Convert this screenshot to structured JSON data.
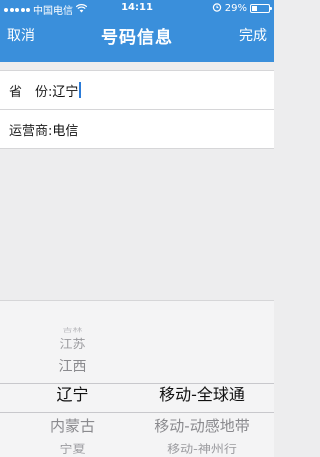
{
  "status_bar": {
    "carrier": "中国电信",
    "time": "14:11",
    "battery_percent_text": "29%",
    "battery_level": 0.29,
    "icons": [
      "wifi-icon",
      "alarm-clock-icon",
      "battery-icon"
    ]
  },
  "nav": {
    "left_label": "取消",
    "title": "号码信息",
    "right_label": "完成"
  },
  "form": {
    "province_label": "省　份:",
    "province_value": "辽宁",
    "carrier_label": "运营商:",
    "carrier_value": "电信"
  },
  "picker": {
    "provinces": [
      "吉林",
      "江苏",
      "江西",
      "辽宁",
      "内蒙古",
      "宁夏"
    ],
    "selected_province": "辽宁",
    "carriers": [
      "移动-全球通",
      "移动-动感地带",
      "移动-神州行"
    ],
    "selected_carrier": "移动-全球通"
  },
  "colors": {
    "header": "#3a8fdb",
    "text_on_header": "#ffffff",
    "caret": "#2b7bd8"
  }
}
